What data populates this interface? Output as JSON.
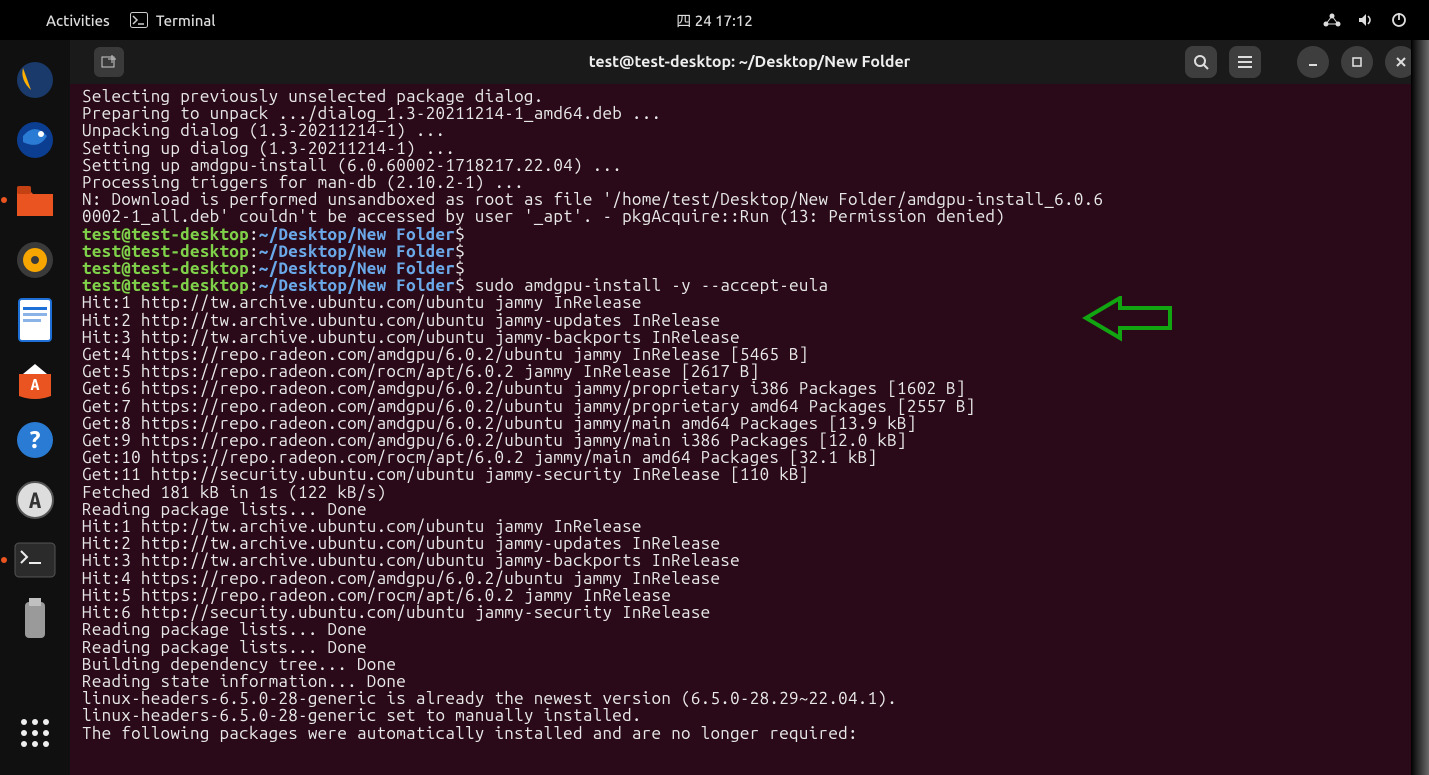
{
  "topbar": {
    "activities": "Activities",
    "app_label": "Terminal",
    "clock": "四 24  17:12"
  },
  "window": {
    "title": "test@test-desktop: ~/Desktop/New Folder"
  },
  "prompt": {
    "userhost": "test@test-desktop",
    "sep": ":",
    "cwd": "~/Desktop/New Folder",
    "sigil": "$",
    "command": "sudo amdgpu-install -y --accept-eula"
  },
  "lines": {
    "pre": [
      "Selecting previously unselected package dialog.",
      "Preparing to unpack .../dialog_1.3-20211214-1_amd64.deb ...",
      "Unpacking dialog (1.3-20211214-1) ...",
      "Setting up dialog (1.3-20211214-1) ...",
      "Setting up amdgpu-install (6.0.60002-1718217.22.04) ...",
      "Processing triggers for man-db (2.10.2-1) ...",
      "N: Download is performed unsandboxed as root as file '/home/test/Desktop/New Folder/amdgpu-install_6.0.6",
      "0002-1_all.deb' couldn't be accessed by user '_apt'. - pkgAcquire::Run (13: Permission denied)"
    ],
    "post": [
      "Hit:1 http://tw.archive.ubuntu.com/ubuntu jammy InRelease",
      "Hit:2 http://tw.archive.ubuntu.com/ubuntu jammy-updates InRelease",
      "Hit:3 http://tw.archive.ubuntu.com/ubuntu jammy-backports InRelease",
      "Get:4 https://repo.radeon.com/amdgpu/6.0.2/ubuntu jammy InRelease [5465 B]",
      "Get:5 https://repo.radeon.com/rocm/apt/6.0.2 jammy InRelease [2617 B]",
      "Get:6 https://repo.radeon.com/amdgpu/6.0.2/ubuntu jammy/proprietary i386 Packages [1602 B]",
      "Get:7 https://repo.radeon.com/amdgpu/6.0.2/ubuntu jammy/proprietary amd64 Packages [2557 B]",
      "Get:8 https://repo.radeon.com/amdgpu/6.0.2/ubuntu jammy/main amd64 Packages [13.9 kB]",
      "Get:9 https://repo.radeon.com/amdgpu/6.0.2/ubuntu jammy/main i386 Packages [12.0 kB]",
      "Get:10 https://repo.radeon.com/rocm/apt/6.0.2 jammy/main amd64 Packages [32.1 kB]",
      "Get:11 http://security.ubuntu.com/ubuntu jammy-security InRelease [110 kB]",
      "Fetched 181 kB in 1s (122 kB/s)",
      "Reading package lists... Done",
      "Hit:1 http://tw.archive.ubuntu.com/ubuntu jammy InRelease",
      "Hit:2 http://tw.archive.ubuntu.com/ubuntu jammy-updates InRelease",
      "Hit:3 http://tw.archive.ubuntu.com/ubuntu jammy-backports InRelease",
      "Hit:4 https://repo.radeon.com/amdgpu/6.0.2/ubuntu jammy InRelease",
      "Hit:5 https://repo.radeon.com/rocm/apt/6.0.2 jammy InRelease",
      "Hit:6 http://security.ubuntu.com/ubuntu jammy-security InRelease",
      "Reading package lists... Done",
      "Reading package lists... Done",
      "Building dependency tree... Done",
      "Reading state information... Done",
      "linux-headers-6.5.0-28-generic is already the newest version (6.5.0-28.29~22.04.1).",
      "linux-headers-6.5.0-28-generic set to manually installed.",
      "The following packages were automatically installed and are no longer required:"
    ]
  },
  "dock": {
    "items": [
      {
        "name": "firefox-icon",
        "color": "#ff7139"
      },
      {
        "name": "thunderbird-icon",
        "color": "#1f6fd0"
      },
      {
        "name": "files-icon",
        "color": "#e95420"
      },
      {
        "name": "rhythmbox-icon",
        "color": "#f7a600"
      },
      {
        "name": "writer-icon",
        "color": "#1e6fd6"
      },
      {
        "name": "software-icon",
        "color": "#e95420"
      },
      {
        "name": "help-icon",
        "color": "#2a7bd4"
      },
      {
        "name": "updates-icon",
        "color": "#4a4a4a"
      },
      {
        "name": "terminal-icon",
        "color": "#2b2b2b"
      },
      {
        "name": "usb-icon",
        "color": "#8a8a8a"
      }
    ]
  }
}
